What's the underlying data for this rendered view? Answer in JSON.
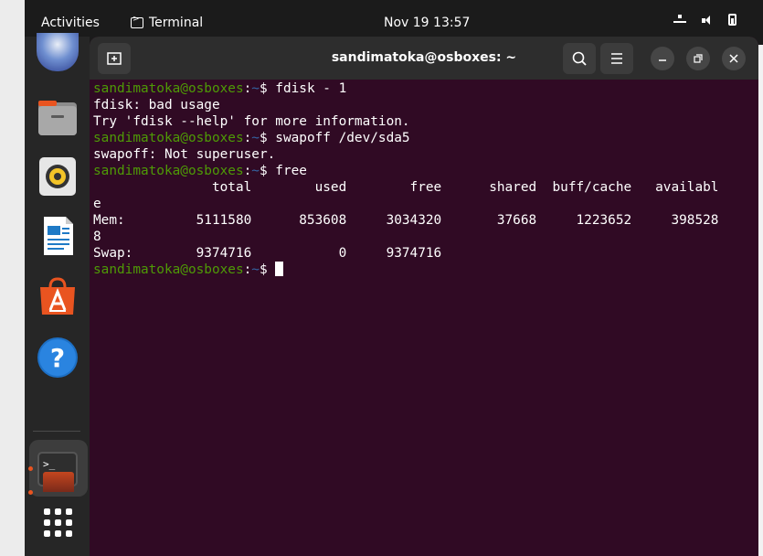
{
  "topbar": {
    "activities": "Activities",
    "app_name": "Terminal",
    "clock": "Nov 19  13:57"
  },
  "window": {
    "title": "sandimatoka@osboxes: ~"
  },
  "terminal": {
    "user_host": "sandimatoka@osboxes",
    "path": "~",
    "commands": [
      "fdisk - 1",
      "swapoff /dev/sda5",
      "free"
    ],
    "output": {
      "fdisk_err1": "fdisk: bad usage",
      "fdisk_err2": "Try 'fdisk --help' for more information.",
      "swapoff_err": "swapoff: Not superuser.",
      "free_header": "               total        used        free      shared  buff/cache   availabl",
      "free_header_wrap": "e",
      "mem_row": "Mem:         5111580      853608     3034320       37668     1223652     398528",
      "mem_wrap": "8",
      "swap_row": "Swap:        9374716           0     9374716"
    }
  },
  "colors": {
    "terminal_bg": "#300a24",
    "prompt_user": "#4e9a06",
    "prompt_path": "#3465a4",
    "accent": "#e95420"
  }
}
